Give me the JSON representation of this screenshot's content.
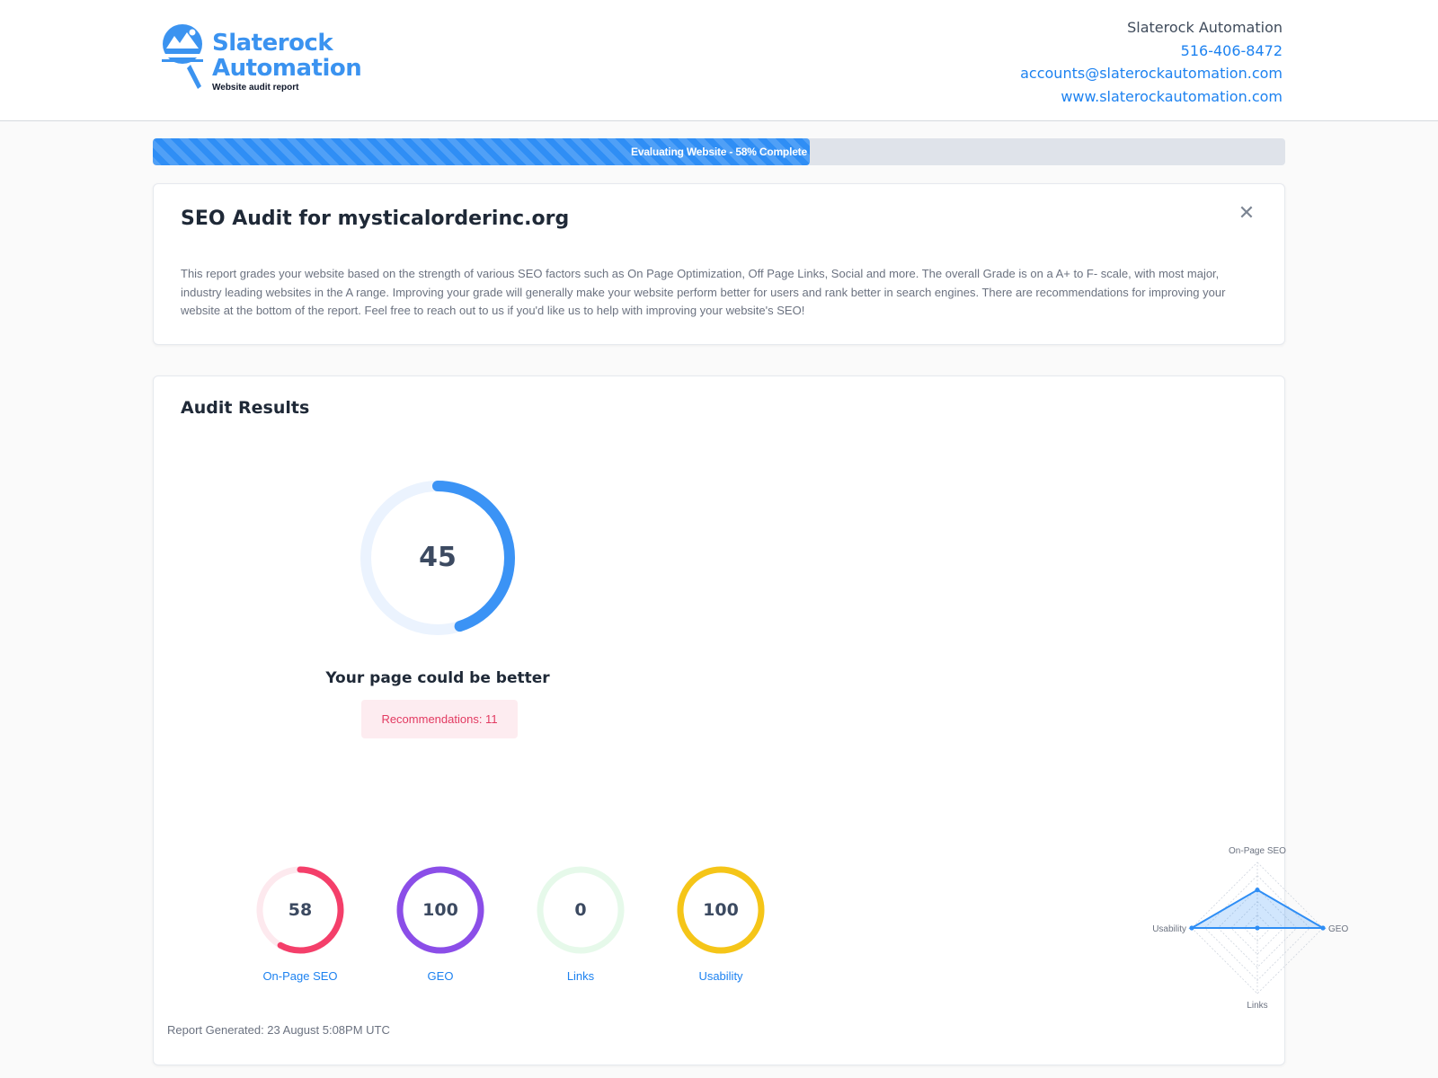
{
  "header": {
    "logo_line1": "Slaterock",
    "logo_line2": "Automation",
    "logo_tagline": "Website audit report",
    "company": "Slaterock Automation",
    "phone": "516-406-8472",
    "email": "accounts@slaterockautomation.com",
    "website": "www.slaterockautomation.com"
  },
  "progress": {
    "label": "Evaluating Website - 58% Complete",
    "percent": 58
  },
  "intro": {
    "title": "SEO Audit for mysticalorderinc.org",
    "close_icon": "close-icon",
    "description": "This report grades your website based on the strength of various SEO factors such as On Page Optimization, Off Page Links, Social and more. The overall Grade is on a A+ to F- scale, with most major, industry leading websites in the A range. Improving your grade will generally make your website perform better for users and rank better in search engines. There are recommendations for improving your website at the bottom of the report. Feel free to reach out to us if you'd like us to help with improving your website's SEO!"
  },
  "results": {
    "title": "Audit Results",
    "overall_score": "45",
    "overall_percent": 45,
    "verdict": "Your page could be better",
    "recommendations": "Recommendations: 11",
    "categories": [
      {
        "label": "On-Page SEO",
        "value": "58",
        "percent": 58,
        "color": "#f43f6a",
        "track": "#fde9ee"
      },
      {
        "label": "GEO",
        "value": "100",
        "percent": 100,
        "color": "#8b4ee8",
        "track": "#efe6fc"
      },
      {
        "label": "Links",
        "value": "0",
        "percent": 0,
        "color": "#22c55e",
        "track": "#e6f9ea"
      },
      {
        "label": "Usability",
        "value": "100",
        "percent": 100,
        "color": "#f5c518",
        "track": "#fdf4d2"
      }
    ],
    "report_generated": "Report Generated: 23 August 5:08PM UTC"
  },
  "chart_data": {
    "type": "radar",
    "axes": [
      "On-Page SEO",
      "GEO",
      "Links",
      "Usability"
    ],
    "values": [
      58,
      100,
      0,
      100
    ],
    "range": [
      0,
      100
    ],
    "color": "#2f8ef5"
  }
}
